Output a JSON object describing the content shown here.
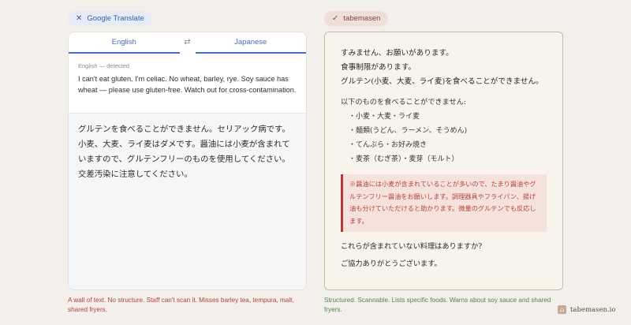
{
  "left_badge": {
    "icon": "close-icon",
    "label": "Google Translate"
  },
  "right_badge": {
    "icon": "check-icon",
    "label": "tabemasen"
  },
  "google_translate": {
    "tab_source": "English",
    "tab_target": "Japanese",
    "swap_icon": "⇄",
    "detected": "English — detected",
    "source_text": "I can't eat gluten. I'm celiac. No wheat, barley, rye. Soy sauce has wheat — please use gluten-free. Watch out for cross-contamination.",
    "output_text": "グルテンを食べることができません。セリアック病です。小麦、大麦、ライ麦はダメです。醤油には小麦が含まれていますので、グルテンフリーのものを使用してください。交差汚染に注意してください。"
  },
  "tabemasen": {
    "line1": "すみません、お願いがあります。",
    "line2": "食事制限があります。",
    "line3": "グルテン(小麦、大麦、ライ麦)を食べることができません。",
    "list_title": "以下のものを食べることができません:",
    "list_items": [
      "小麦・大麦・ライ麦",
      "麺類(うどん、ラーメン、そうめん)",
      "てんぷら・お好み焼き",
      "麦茶（むぎ茶）・麦芽（モルト）"
    ],
    "warning": "※醤油には小麦が含まれていることが多いので、たまり醤油やグルテンフリー醤油をお願いします。調理器具やフライパン、揚げ油も分けていただけると助かります。微量のグルテンでも反応します。",
    "question": "これらが含まれていない料理はありますか?",
    "thanks": "ご協力ありがとうございます。"
  },
  "captions": {
    "left": "A wall of text. No structure. Staff can't scan it. Misses barley tea, tempura, malt, shared fryers.",
    "right": "Structured. Scannable. Lists specific foods. Warns about soy sauce and shared fryers."
  },
  "logo": {
    "text": "tabemasen.io"
  },
  "colors": {
    "background": "#f3efea",
    "google_accent": "#4a6fb8",
    "warning_red": "#b03a3a",
    "good_green": "#4f8a4a"
  }
}
